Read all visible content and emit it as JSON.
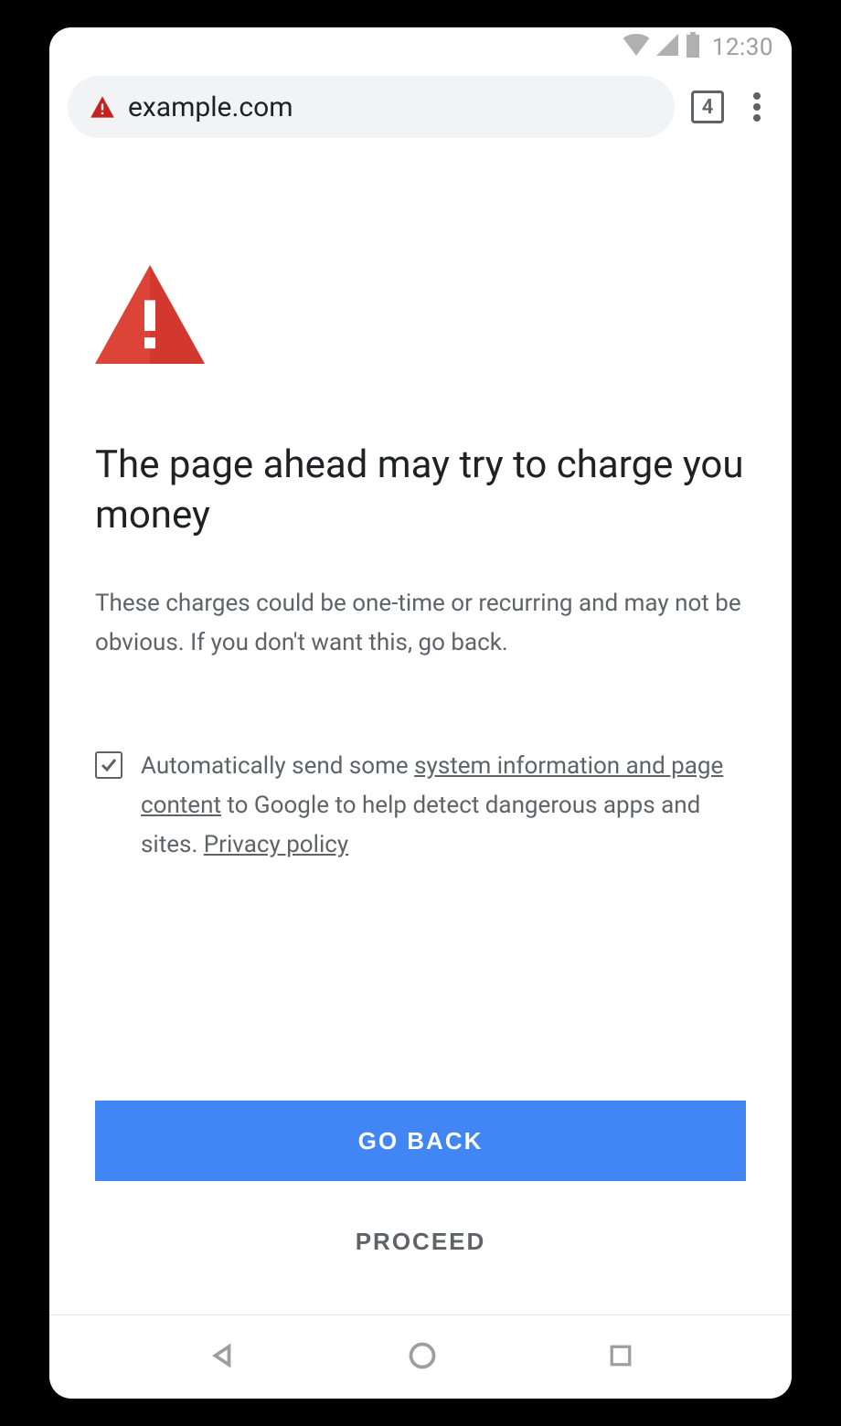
{
  "statusbar": {
    "time": "12:30"
  },
  "toolbar": {
    "url": "example.com",
    "tab_count": "4"
  },
  "warning": {
    "heading": "The page ahead may try to charge you money",
    "body": "These charges could be one-time or recurring and may not be obvious. If you don't want this, go back."
  },
  "reporting": {
    "pre_text": "Automatically send some ",
    "link1": "system information and page content",
    "mid_text": " to Google to help detect dangerous apps and sites. ",
    "link2": "Privacy policy",
    "checked": true
  },
  "buttons": {
    "primary": "GO BACK",
    "secondary": "PROCEED"
  }
}
